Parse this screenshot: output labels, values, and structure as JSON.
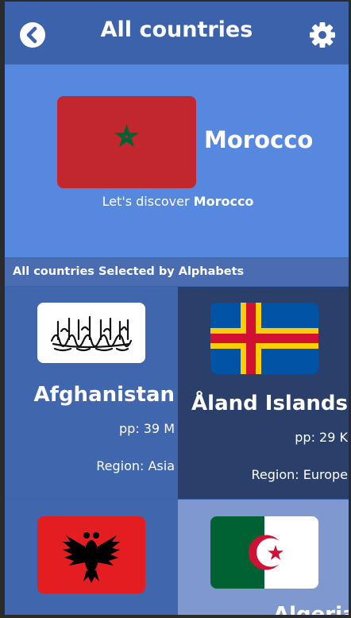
{
  "header": {
    "title": "All countries",
    "back_icon": "chevron-left-circle-icon",
    "settings_icon": "gear-icon"
  },
  "hero": {
    "country": "Morocco",
    "subtitle_prefix": "Let's discover ",
    "subtitle_country": "Morocco"
  },
  "section": {
    "label": "All countries Selected by Alphabets"
  },
  "countries": [
    {
      "name": "Afghanistan",
      "population": "pp: 39 M",
      "region": "Region: Asia"
    },
    {
      "name": "Åland Islands",
      "population": "pp: 29 K",
      "region": "Region: Europe"
    },
    {
      "name": "",
      "population": "",
      "region": ""
    },
    {
      "name": "Algeria",
      "population": "",
      "region": ""
    }
  ],
  "colors": {
    "header_bg": "#3c62ab",
    "hero_bg": "#5788e0",
    "card_dark": "#2b3f6b",
    "card_light": "#7f98cf"
  }
}
